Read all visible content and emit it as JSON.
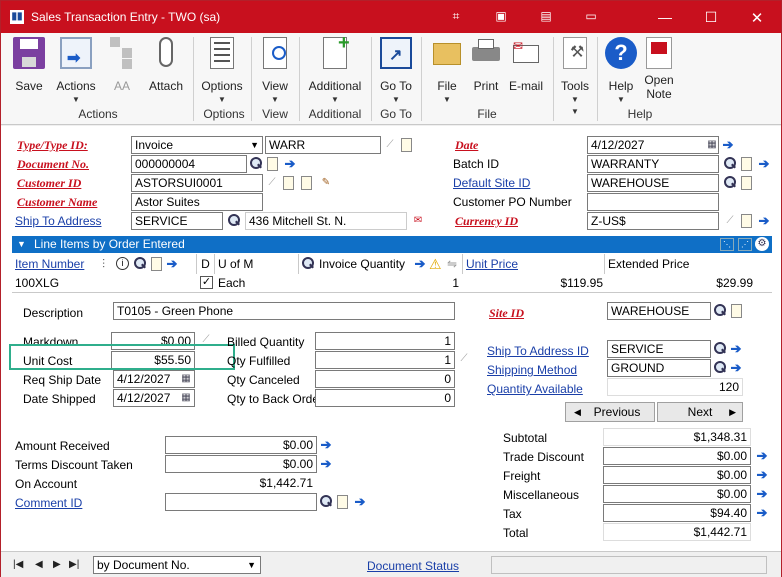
{
  "window": {
    "title": "Sales Transaction Entry  -  TWO (sa)"
  },
  "ribbon": {
    "buttons": [
      {
        "name": "save",
        "label": "Save"
      },
      {
        "name": "actions",
        "label": "Actions"
      },
      {
        "name": "aa",
        "label": "AA"
      },
      {
        "name": "attach",
        "label": "Attach"
      },
      {
        "name": "options",
        "label": "Options"
      },
      {
        "name": "view",
        "label": "View"
      },
      {
        "name": "additional",
        "label": "Additional"
      },
      {
        "name": "goto",
        "label": "Go To"
      },
      {
        "name": "file",
        "label": "File"
      },
      {
        "name": "print",
        "label": "Print"
      },
      {
        "name": "email",
        "label": "E-mail"
      },
      {
        "name": "tools",
        "label": "Tools"
      },
      {
        "name": "help",
        "label": "Help"
      },
      {
        "name": "opennote",
        "label": "Open Note"
      }
    ],
    "groups": {
      "actions": "Actions",
      "options": "Options",
      "view": "View",
      "additional": "Additional",
      "goto": "Go To",
      "file": "File",
      "help": "Help"
    }
  },
  "header": {
    "type_label": "Type/Type ID:",
    "type_value": "Invoice",
    "type_id": "WARR",
    "docno_label": "Document No.",
    "docno_value": "000000004",
    "custid_label": "Customer ID",
    "custid_value": "ASTORSUI0001",
    "custname_label": "Customer Name",
    "custname_value": "Astor Suites",
    "shipto_label": "Ship To Address",
    "shipto_value": "SERVICE",
    "shipto_addr": "436 Mitchell St. N.",
    "date_label": "Date",
    "date_value": "4/12/2027",
    "batch_label": "Batch ID",
    "batch_value": "WARRANTY",
    "site_label": "Default Site ID",
    "site_value": "WAREHOUSE",
    "po_label": "Customer PO Number",
    "po_value": "",
    "curr_label": "Currency ID",
    "curr_value": "Z-US$"
  },
  "lineitems": {
    "title": "Line Items by Order Entered",
    "cols": {
      "item": "Item Number",
      "d": "D",
      "uom": "U of M",
      "qty": "Invoice Quantity",
      "price": "Unit Price",
      "ext": "Extended Price"
    },
    "row": {
      "item": "100XLG",
      "uom": "Each",
      "qty": "1",
      "price": "$119.95",
      "ext": "$29.99"
    }
  },
  "detail": {
    "desc_label": "Description",
    "desc_value": "T0105 - Green Phone",
    "markdown_label": "Markdown",
    "markdown_value": "$0.00",
    "unitcost_label": "Unit Cost",
    "unitcost_value": "$55.50",
    "reqship_label": "Req Ship Date",
    "reqship_value": "4/12/2027",
    "shipped_label": "Date Shipped",
    "shipped_value": "4/12/2027",
    "billed_label": "Billed Quantity",
    "billed_value": "1",
    "fulfilled_label": "Qty Fulfilled",
    "fulfilled_value": "1",
    "canceled_label": "Qty Canceled",
    "canceled_value": "0",
    "backorder_label": "Qty to Back Order",
    "backorder_value": "0",
    "siteid_label": "Site ID",
    "siteid_value": "WAREHOUSE",
    "shipaddr_label": "Ship To Address ID",
    "shipaddr_value": "SERVICE",
    "shipmeth_label": "Shipping Method",
    "shipmeth_value": "GROUND",
    "qtyavail_label": "Quantity Available",
    "qtyavail_value": "120",
    "previous": "Previous",
    "next": "Next"
  },
  "totals": {
    "amtrec_label": "Amount Received",
    "amtrec_value": "$0.00",
    "terms_label": "Terms Discount Taken",
    "terms_value": "$0.00",
    "onacct_label": "On Account",
    "onacct_value": "$1,442.71",
    "comment_label": "Comment ID",
    "comment_value": "",
    "subtotal_label": "Subtotal",
    "subtotal_value": "$1,348.31",
    "trade_label": "Trade Discount",
    "trade_value": "$0.00",
    "freight_label": "Freight",
    "freight_value": "$0.00",
    "misc_label": "Miscellaneous",
    "misc_value": "$0.00",
    "tax_label": "Tax",
    "tax_value": "$94.40",
    "total_label": "Total",
    "total_value": "$1,442.71"
  },
  "status": {
    "sort_value": "by Document No.",
    "docstatus": "Document Status"
  }
}
